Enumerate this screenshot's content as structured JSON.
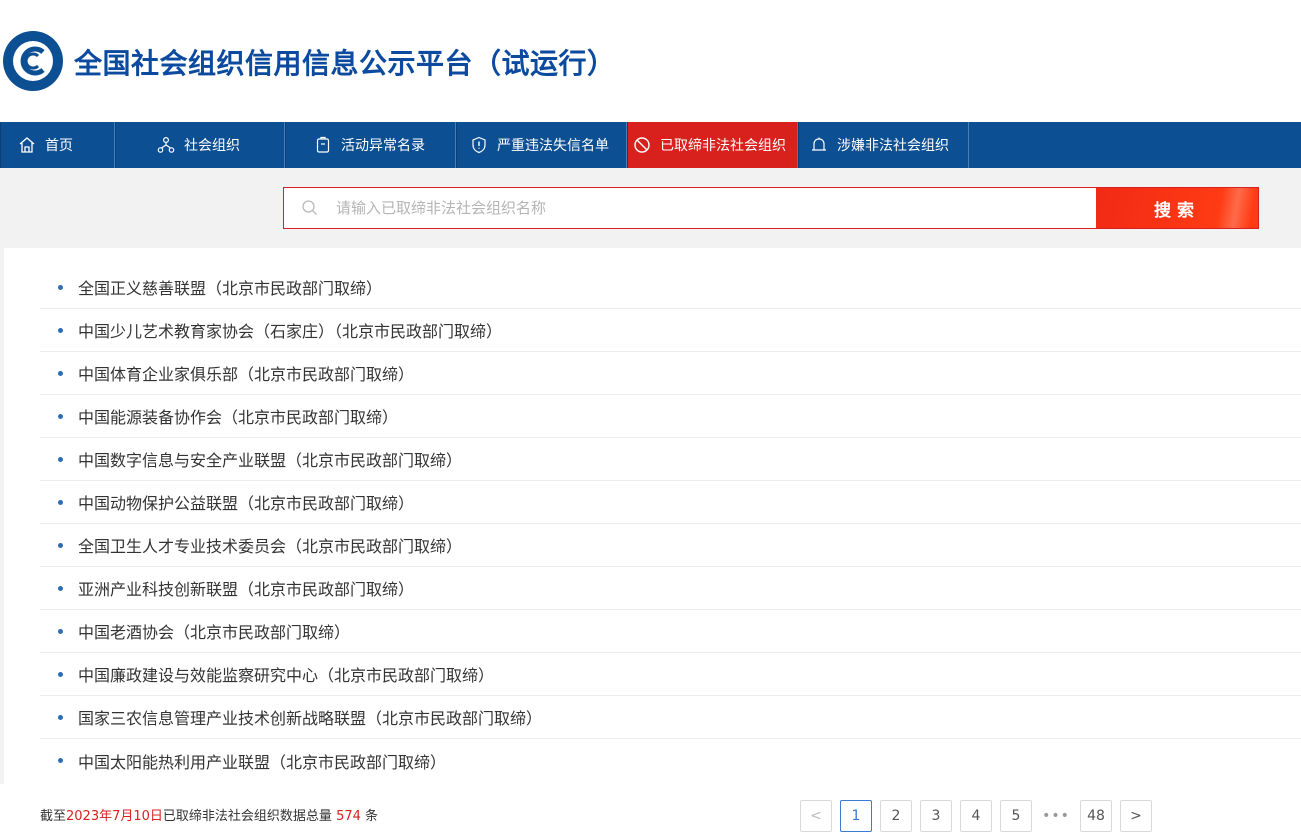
{
  "site": {
    "title": "全国社会组织信用信息公示平台（试运行）"
  },
  "nav": [
    {
      "label": "首页",
      "icon": "home-icon"
    },
    {
      "label": "社会组织",
      "icon": "org-icon"
    },
    {
      "label": "活动异常名录",
      "icon": "clipboard-icon"
    },
    {
      "label": "严重违法失信名单",
      "icon": "shield-icon"
    },
    {
      "label": "已取缔非法社会组织",
      "icon": "ban-icon",
      "active": true
    },
    {
      "label": "涉嫌非法社会组织",
      "icon": "bell-icon"
    }
  ],
  "search": {
    "placeholder": "请输入已取缔非法社会组织名称",
    "value": "",
    "button": "搜索"
  },
  "list": [
    "全国正义慈善联盟（北京市民政部门取缔）",
    "中国少儿艺术教育家协会（石家庄）（北京市民政部门取缔）",
    "中国体育企业家俱乐部（北京市民政部门取缔）",
    "中国能源装备协作会（北京市民政部门取缔）",
    "中国数字信息与安全产业联盟（北京市民政部门取缔）",
    "中国动物保护公益联盟（北京市民政部门取缔）",
    "全国卫生人才专业技术委员会（北京市民政部门取缔）",
    "亚洲产业科技创新联盟（北京市民政部门取缔）",
    "中国老酒协会（北京市民政部门取缔）",
    "中国廉政建设与效能监察研究中心（北京市民政部门取缔）",
    "国家三农信息管理产业技术创新战略联盟（北京市民政部门取缔）",
    "中国太阳能热利用产业联盟（北京市民政部门取缔）"
  ],
  "footer": {
    "prefix": "截至",
    "date": "2023年7月10日",
    "middle": "已取缔非法社会组织数据总量",
    "count": "574",
    "suffix": "条"
  },
  "pagination": {
    "prev": "<",
    "pages": [
      "1",
      "2",
      "3",
      "4",
      "5"
    ],
    "ellipsis": "•••",
    "last": "48",
    "next": ">",
    "current": "1"
  },
  "colors": {
    "nav_bg": "#0d4f93",
    "active_red": "#d8211d",
    "title_blue": "#0b4a9e"
  }
}
